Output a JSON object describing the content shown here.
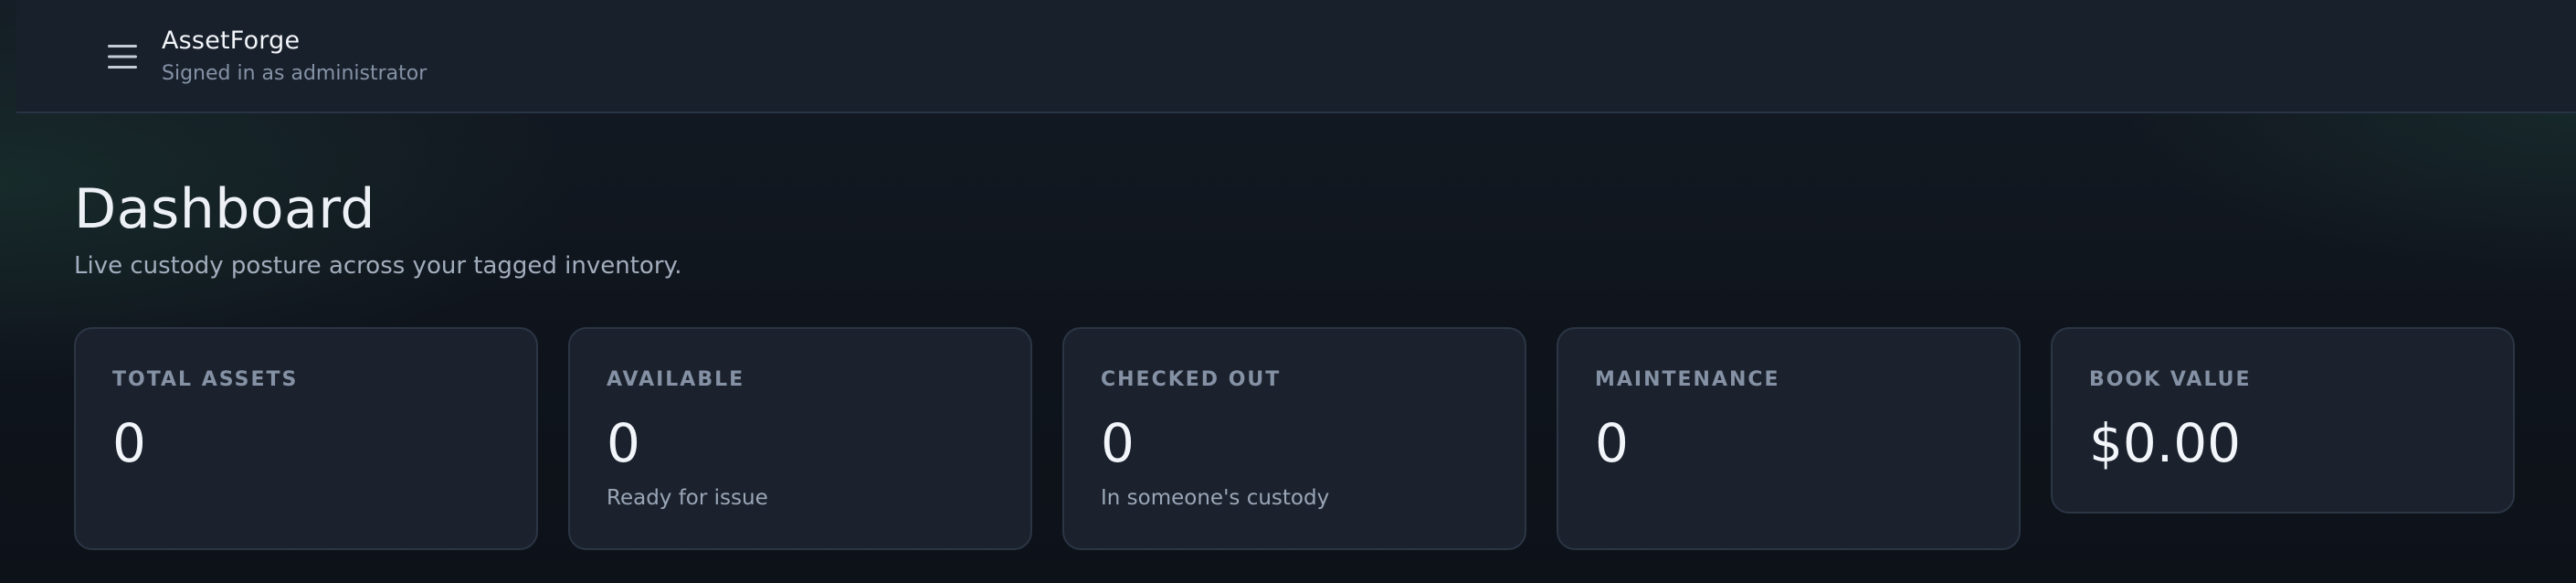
{
  "header": {
    "app_name": "AssetForge",
    "subtitle": "Signed in as administrator",
    "menu_icon": "hamburger-menu-icon"
  },
  "page": {
    "title": "Dashboard",
    "subtitle": "Live custody posture across your tagged inventory."
  },
  "stats": [
    {
      "label": "TOTAL ASSETS",
      "value": "0",
      "note": ""
    },
    {
      "label": "AVAILABLE",
      "value": "0",
      "note": "Ready for issue"
    },
    {
      "label": "CHECKED OUT",
      "value": "0",
      "note": "In someone's custody"
    },
    {
      "label": "MAINTENANCE",
      "value": "0",
      "note": ""
    },
    {
      "label": "BOOK VALUE",
      "value": "$0.00",
      "note": ""
    }
  ],
  "colors": {
    "background": "#0f141c",
    "card": "#1b222d",
    "border": "#2b3544",
    "text_primary": "#f2f5f9",
    "text_muted": "#8591a4"
  }
}
